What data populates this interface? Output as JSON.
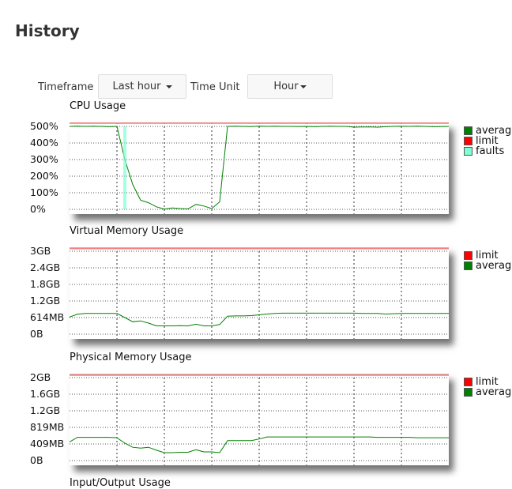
{
  "page": {
    "title": "History"
  },
  "controls": {
    "timeframe_label": "Timeframe",
    "timeframe_value": "Last hour",
    "timeunit_label": "Time Unit",
    "timeunit_value": "Hour"
  },
  "colors": {
    "average": "#008000",
    "limit": "#ff0000",
    "limit_line": "#f08080",
    "faults": "#7fffd4"
  },
  "chart_data": [
    {
      "type": "line",
      "title": "CPU Usage",
      "unit": "%",
      "ylim": [
        0,
        500
      ],
      "yticks": [
        0,
        100,
        200,
        300,
        400,
        500
      ],
      "ytick_labels": [
        "0%",
        "100%",
        "200%",
        "300%",
        "400%",
        "500%"
      ],
      "grid": true,
      "legend": [
        "average",
        "limit",
        "faults"
      ],
      "series": [
        {
          "name": "average",
          "values": [
            500,
            502,
            500,
            501,
            500,
            498,
            500,
            300,
            150,
            55,
            40,
            15,
            2,
            8,
            5,
            3,
            30,
            20,
            5,
            45,
            500,
            501,
            500,
            499,
            502,
            500,
            501,
            500,
            500,
            499,
            500,
            498,
            500,
            501,
            500,
            500,
            495,
            496,
            497,
            495,
            498,
            500,
            501,
            500,
            502,
            500,
            498,
            499,
            500
          ]
        },
        {
          "name": "limit",
          "values": [
            520,
            520,
            520,
            520,
            520,
            520,
            520,
            520,
            520,
            520,
            520,
            520,
            520,
            520,
            520,
            520,
            520,
            520,
            520,
            520,
            520,
            520,
            520,
            520,
            520,
            520,
            520,
            520,
            520,
            520,
            520,
            520,
            520,
            520,
            520,
            520,
            520,
            520,
            520,
            520,
            520,
            520,
            520,
            520,
            520,
            520,
            520,
            520,
            520
          ]
        },
        {
          "name": "faults",
          "values": [
            0,
            0,
            0,
            0,
            0,
            0,
            0,
            500,
            0,
            0,
            0,
            0,
            0,
            0,
            0,
            0,
            0,
            0,
            0,
            0,
            0,
            0,
            0,
            0,
            0,
            0,
            0,
            0,
            0,
            0,
            0,
            0,
            0,
            0,
            0,
            0,
            0,
            0,
            0,
            0,
            0,
            0,
            0,
            0,
            0,
            0,
            0,
            0,
            0
          ]
        }
      ]
    },
    {
      "type": "line",
      "title": "Virtual Memory Usage",
      "unit": "GB",
      "ylim": [
        0,
        3
      ],
      "yticks": [
        0,
        0.6,
        1.2,
        1.8,
        2.4,
        3
      ],
      "ytick_labels": [
        "0B",
        "614MB",
        "1.2GB",
        "1.8GB",
        "2.4GB",
        "3GB"
      ],
      "grid": true,
      "legend": [
        "limit",
        "average"
      ],
      "series": [
        {
          "name": "limit",
          "values": [
            3.1,
            3.1,
            3.1,
            3.1,
            3.1,
            3.1,
            3.1,
            3.1,
            3.1,
            3.1,
            3.1,
            3.1,
            3.1,
            3.1,
            3.1,
            3.1,
            3.1,
            3.1,
            3.1,
            3.1,
            3.1,
            3.1,
            3.1,
            3.1,
            3.1,
            3.1,
            3.1,
            3.1,
            3.1,
            3.1,
            3.1,
            3.1,
            3.1,
            3.1,
            3.1,
            3.1,
            3.1,
            3.1,
            3.1,
            3.1,
            3.1,
            3.1,
            3.1,
            3.1,
            3.1,
            3.1,
            3.1,
            3.1,
            3.1
          ]
        },
        {
          "name": "average",
          "values": [
            0.62,
            0.72,
            0.75,
            0.75,
            0.75,
            0.75,
            0.75,
            0.6,
            0.45,
            0.48,
            0.4,
            0.3,
            0.3,
            0.3,
            0.31,
            0.3,
            0.36,
            0.3,
            0.3,
            0.35,
            0.65,
            0.66,
            0.66,
            0.67,
            0.7,
            0.73,
            0.75,
            0.76,
            0.76,
            0.76,
            0.76,
            0.76,
            0.76,
            0.76,
            0.76,
            0.76,
            0.76,
            0.75,
            0.75,
            0.75,
            0.73,
            0.74,
            0.75,
            0.75,
            0.75,
            0.75,
            0.75,
            0.75,
            0.75
          ]
        }
      ]
    },
    {
      "type": "line",
      "title": "Physical Memory Usage",
      "unit": "GB",
      "ylim": [
        0,
        2
      ],
      "yticks": [
        0,
        0.4,
        0.8,
        1.2,
        1.6,
        2
      ],
      "ytick_labels": [
        "0B",
        "409MB",
        "819MB",
        "1.2GB",
        "1.6GB",
        "2GB"
      ],
      "grid": true,
      "legend": [
        "limit",
        "average"
      ],
      "series": [
        {
          "name": "limit",
          "values": [
            2.06,
            2.06,
            2.06,
            2.06,
            2.06,
            2.06,
            2.06,
            2.06,
            2.06,
            2.06,
            2.06,
            2.06,
            2.06,
            2.06,
            2.06,
            2.06,
            2.06,
            2.06,
            2.06,
            2.06,
            2.06,
            2.06,
            2.06,
            2.06,
            2.06,
            2.06,
            2.06,
            2.06,
            2.06,
            2.06,
            2.06,
            2.06,
            2.06,
            2.06,
            2.06,
            2.06,
            2.06,
            2.06,
            2.06,
            2.06,
            2.06,
            2.06,
            2.06,
            2.06,
            2.06,
            2.06,
            2.06,
            2.06,
            2.06
          ]
        },
        {
          "name": "average",
          "values": [
            0.45,
            0.56,
            0.56,
            0.56,
            0.56,
            0.56,
            0.55,
            0.42,
            0.32,
            0.3,
            0.32,
            0.25,
            0.19,
            0.19,
            0.2,
            0.2,
            0.26,
            0.21,
            0.21,
            0.19,
            0.48,
            0.48,
            0.48,
            0.48,
            0.52,
            0.57,
            0.57,
            0.57,
            0.57,
            0.57,
            0.57,
            0.57,
            0.57,
            0.57,
            0.57,
            0.57,
            0.57,
            0.57,
            0.57,
            0.56,
            0.56,
            0.56,
            0.56,
            0.56,
            0.55,
            0.55,
            0.55,
            0.55,
            0.55
          ]
        }
      ]
    }
  ],
  "next_chart": {
    "title": "Input/Output Usage"
  }
}
